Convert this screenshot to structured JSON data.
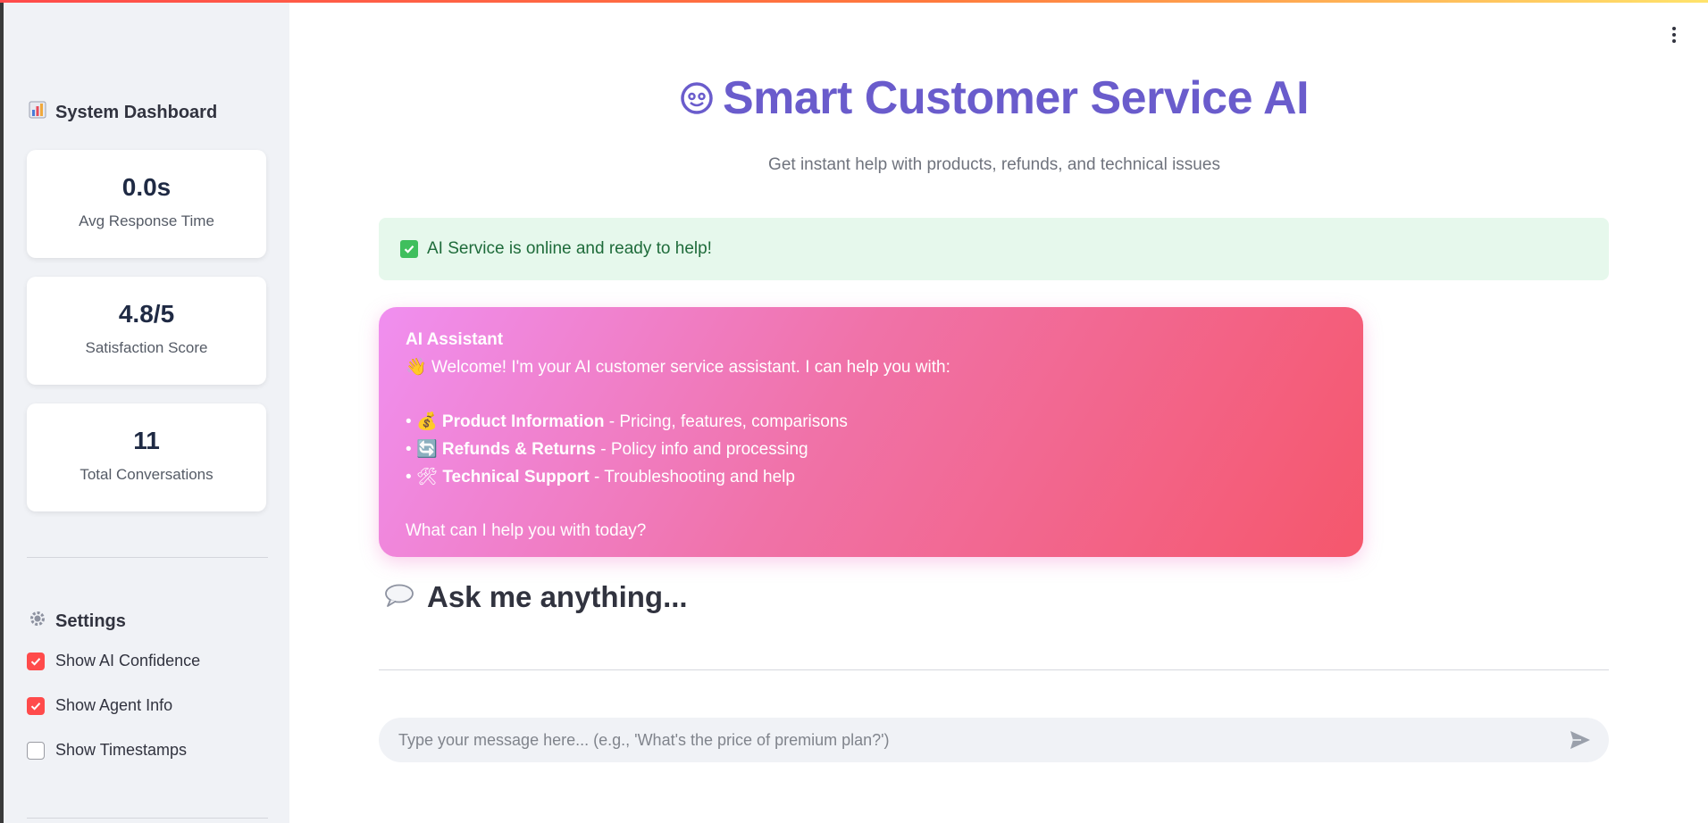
{
  "sidebar": {
    "dashboard_title": "System Dashboard",
    "metrics": [
      {
        "value": "0.0s",
        "label": "Avg Response Time"
      },
      {
        "value": "4.8/5",
        "label": "Satisfaction Score"
      },
      {
        "value": "11",
        "label": "Total Conversations"
      }
    ],
    "settings_title": "Settings",
    "settings": [
      {
        "label": "Show AI Confidence",
        "checked": true
      },
      {
        "label": "Show Agent Info",
        "checked": true
      },
      {
        "label": "Show Timestamps",
        "checked": false
      }
    ]
  },
  "header": {
    "title": "Smart Customer Service AI",
    "subtitle": "Get instant help with products, refunds, and technical issues"
  },
  "status": {
    "text": "AI Service is online and ready to help!"
  },
  "assistant_message": {
    "sender": "AI Assistant",
    "intro": "Welcome! I'm your AI customer service assistant. I can help you with:",
    "items": [
      {
        "bullet": "•",
        "title": "Product Information",
        "desc": " - Pricing, features, comparisons"
      },
      {
        "bullet": "•",
        "title": "Refunds & Returns",
        "desc": " - Policy info and processing"
      },
      {
        "bullet": "•",
        "title": "Technical Support",
        "desc": " - Troubleshooting and help"
      }
    ],
    "closing": "What can I help you with today?"
  },
  "ask": {
    "heading": "Ask me anything..."
  },
  "chat_input": {
    "placeholder": "Type your message here... (e.g., 'What's the price of premium plan?')",
    "value": ""
  },
  "colors": {
    "accent": "#ff4b4b",
    "title": "#6a5ccc",
    "status_bg": "#e6f8ec",
    "status_text": "#1e6b3a"
  }
}
